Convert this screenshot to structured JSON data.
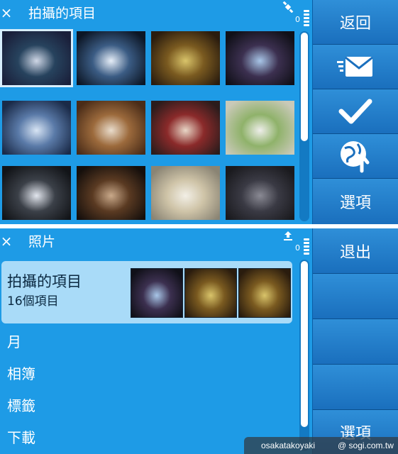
{
  "screen1": {
    "title": "拍攝的項目",
    "close_label": "×",
    "battery_label": "0",
    "scroll_fraction": 0.42,
    "softkeys": [
      {
        "name": "back",
        "label": "返回",
        "icon": null
      },
      {
        "name": "send",
        "label": "",
        "icon": "send-envelope-icon"
      },
      {
        "name": "mark",
        "label": "",
        "icon": "checkmark-icon"
      },
      {
        "name": "share-online",
        "label": "",
        "icon": "share-online-icon"
      },
      {
        "name": "options",
        "label": "選項",
        "icon": null
      }
    ],
    "thumbnails": [
      {
        "subject": "night-street-fireworks",
        "colors": [
          "#1a1f3a",
          "#27435e",
          "#cfd7e6"
        ]
      },
      {
        "subject": "shop-storefront",
        "colors": [
          "#0c1625",
          "#3b5c84",
          "#e6eef8"
        ]
      },
      {
        "subject": "bar-sign-interior",
        "colors": [
          "#2a1c0e",
          "#7a5a20",
          "#d9c46a"
        ]
      },
      {
        "subject": "restaurant-sign-interior",
        "colors": [
          "#101018",
          "#3c3050",
          "#a8c6e8"
        ]
      },
      {
        "subject": "ice-sculpture-drink",
        "colors": [
          "#1a2a48",
          "#5a7aa8",
          "#d7e4f4"
        ]
      },
      {
        "subject": "noodle-bowl",
        "colors": [
          "#4a2c18",
          "#9c6a3c",
          "#e9dccb"
        ]
      },
      {
        "subject": "woman-portrait",
        "colors": [
          "#2b1c1c",
          "#8b2a2a",
          "#e8d6c6"
        ]
      },
      {
        "subject": "salad-plate",
        "colors": [
          "#c9c9b8",
          "#8fb26a",
          "#eeeeea"
        ]
      },
      {
        "subject": "clock-glass",
        "colors": [
          "#121418",
          "#3b4048",
          "#e2e6ee"
        ]
      },
      {
        "subject": "iced-cola-glass",
        "colors": [
          "#150f0c",
          "#5a3a22",
          "#c9a98a"
        ]
      },
      {
        "subject": "soup-bowl",
        "colors": [
          "#8a8474",
          "#cfc4a8",
          "#f2efe6"
        ]
      },
      {
        "subject": "dark-tabletop",
        "colors": [
          "#1a1a1e",
          "#3a3a44",
          "#8a8a94"
        ]
      }
    ]
  },
  "screen2": {
    "title": "照片",
    "close_label": "×",
    "battery_label": "0",
    "scroll_fraction": 0.12,
    "album": {
      "title": "拍攝的項目",
      "count": "16個項目",
      "thumbs": [
        {
          "subject": "restaurant-sign-interior",
          "colors": [
            "#101018",
            "#3c3050",
            "#a8c6e8"
          ]
        },
        {
          "subject": "bar-sign-interior",
          "colors": [
            "#2a1c0e",
            "#7a5a20",
            "#d9c46a"
          ]
        },
        {
          "subject": "bar-sign-interior",
          "colors": [
            "#2a1c0e",
            "#7a5a20",
            "#d9c46a"
          ]
        }
      ]
    },
    "menu": [
      {
        "name": "month",
        "label": "月"
      },
      {
        "name": "albums",
        "label": "相簿"
      },
      {
        "name": "tags",
        "label": "標籤"
      },
      {
        "name": "downloads",
        "label": "下載"
      }
    ],
    "softkeys": [
      {
        "name": "exit",
        "label": "退出"
      },
      {
        "name": "empty-1",
        "label": ""
      },
      {
        "name": "empty-2",
        "label": ""
      },
      {
        "name": "empty-3",
        "label": ""
      },
      {
        "name": "options",
        "label": "選項"
      }
    ]
  },
  "watermark": {
    "left": "osakatakoyaki",
    "right": "@ sogi.com.tw"
  },
  "colors": {
    "background": "#1e9be6",
    "softkey": "#1a6fbd",
    "album_highlight": "#a9dbf8",
    "text": "#ffffff"
  }
}
